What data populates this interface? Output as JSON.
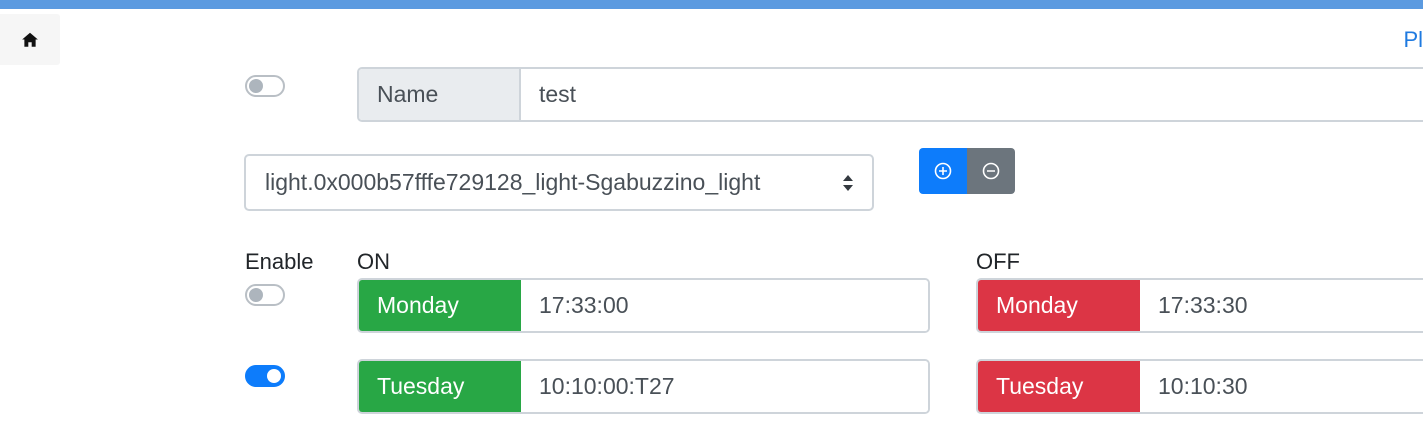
{
  "header": {
    "home_icon": "home-icon",
    "top_right_link": "Pl"
  },
  "scene": {
    "enabled": false,
    "name_label": "Name",
    "name_value": "test"
  },
  "entity": {
    "selected": "light.0x000b57fffe729128_light-Sgabuzzino_light",
    "add_icon": "plus-circle-icon",
    "remove_icon": "minus-circle-icon"
  },
  "schedule": {
    "enable_label": "Enable",
    "on_label": "ON",
    "off_label": "OFF",
    "colors": {
      "on": "#28a745",
      "off": "#dc3545",
      "toggle_on": "#0d7cfb"
    },
    "rows": [
      {
        "enabled": false,
        "on_day": "Monday",
        "on_time": "17:33:00",
        "off_day": "Monday",
        "off_time": "17:33:30"
      },
      {
        "enabled": true,
        "on_day": "Tuesday",
        "on_time": "10:10:00:T27",
        "off_day": "Tuesday",
        "off_time": "10:10:30"
      }
    ]
  }
}
